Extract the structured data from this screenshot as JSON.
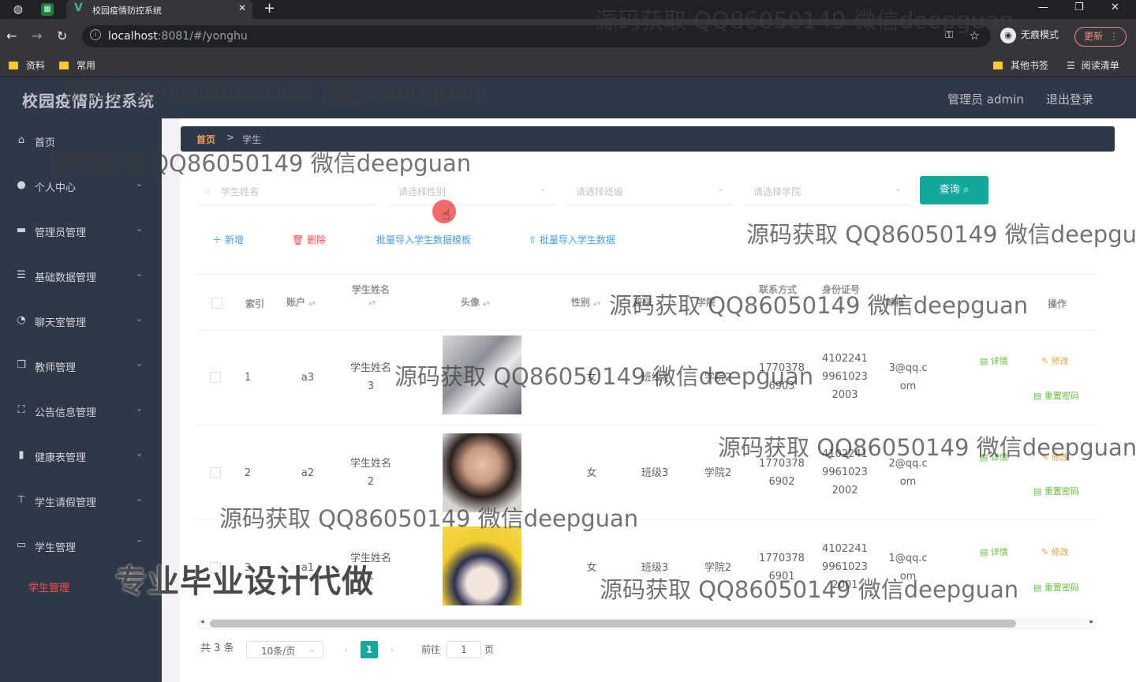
{
  "browser": {
    "tab_title": "校园疫情防控系统",
    "url_host": "localhost",
    "url_rest": ":8081/#/yonghu",
    "incognito_label": "无痕模式",
    "update_label": "更新",
    "bookmarks": [
      "资料",
      "常用"
    ],
    "other_bookmarks": "其他书签",
    "reading_list": "阅读清单"
  },
  "app": {
    "title": "校园疫情防控系统",
    "admin_label": "管理员 admin",
    "logout_label": "退出登录"
  },
  "sidebar": {
    "items": [
      {
        "label": "首页",
        "icon": "home-icon"
      },
      {
        "label": "个人中心",
        "icon": "user-icon"
      },
      {
        "label": "管理员管理",
        "icon": "monitor-icon"
      },
      {
        "label": "基础数据管理",
        "icon": "list-icon"
      },
      {
        "label": "聊天室管理",
        "icon": "chat-icon"
      },
      {
        "label": "教师管理",
        "icon": "copy-icon"
      },
      {
        "label": "公告信息管理",
        "icon": "fullscreen-icon"
      },
      {
        "label": "健康表管理",
        "icon": "bar-chart-icon"
      },
      {
        "label": "学生请假管理",
        "icon": "pin-icon"
      },
      {
        "label": "学生管理",
        "icon": "id-card-icon"
      }
    ],
    "active_sub": "学生管理"
  },
  "breadcrumb": {
    "home": "首页",
    "sep": ">",
    "current": "学生"
  },
  "search": {
    "name_placeholder": "学生姓名",
    "gender_placeholder": "请选择性别",
    "class_placeholder": "请选择班级",
    "college_placeholder": "请选择学院",
    "query_label": "查询"
  },
  "actions": {
    "add": "新增",
    "delete": "删除",
    "import_template": "批量导入学生数据模板",
    "import_data": "批量导入学生数据"
  },
  "table": {
    "headers": [
      "索引",
      "账户",
      "学生姓名",
      "头像",
      "性别",
      "班级",
      "学院",
      "联系方式",
      "身份证号",
      "邮箱",
      "操作"
    ],
    "rows": [
      {
        "index": "1",
        "account": "a3",
        "name1": "学生姓名",
        "name2": "3",
        "gender": "女",
        "class": "班级3",
        "college": "学院2",
        "phone1": "1770378",
        "phone2": "6903",
        "id1": "4102241",
        "id2": "9961023",
        "id3": "2003",
        "email1": "3@qq.c",
        "email2": "om"
      },
      {
        "index": "2",
        "account": "a2",
        "name1": "学生姓名",
        "name2": "2",
        "gender": "女",
        "class": "班级3",
        "college": "学院2",
        "phone1": "1770378",
        "phone2": "6902",
        "id1": "4102241",
        "id2": "9961023",
        "id3": "2002",
        "email1": "2@qq.c",
        "email2": "om"
      },
      {
        "index": "3",
        "account": "a1",
        "name1": "学生姓名",
        "name2": "1",
        "gender": "女",
        "class": "班级3",
        "college": "学院2",
        "phone1": "1770378",
        "phone2": "6901",
        "id1": "4102241",
        "id2": "9961023",
        "id3": "2001",
        "email1": "1@qq.c",
        "email2": "om"
      }
    ],
    "ops": {
      "detail": "详情",
      "edit": "修改",
      "reset": "重置密码"
    }
  },
  "pager": {
    "total": "共 3 条",
    "size": "10条/页",
    "page": "1",
    "goto_prefix": "前往",
    "goto_value": "1",
    "goto_suffix": "页"
  },
  "watermark": {
    "text": "源码获取 QQ86050149 微信deepguan",
    "promo": "专业毕业设计代做"
  },
  "colors": {
    "sidebar_bg": "#2f3847",
    "accent_teal": "#13a89e",
    "link_blue": "#409eff",
    "danger_red": "#ff4d4f",
    "edit_orange": "#e6a23c",
    "detail_green": "#67c23a"
  }
}
